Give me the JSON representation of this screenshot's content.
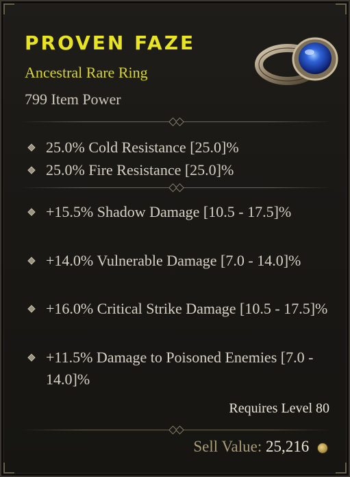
{
  "item": {
    "name": "PROVEN FAZE",
    "type": "Ancestral Rare Ring",
    "power": "799 Item Power"
  },
  "implicits": [
    "25.0% Cold Resistance [25.0]%",
    "25.0% Fire Resistance [25.0]%"
  ],
  "affixes": [
    "+15.5% Shadow Damage [10.5 - 17.5]%",
    "+14.0% Vulnerable Damage [7.0 - 14.0]%",
    "+16.0% Critical Strike Damage [10.5 - 17.5]%",
    "+11.5% Damage to Poisoned Enemies [7.0 - 14.0]%"
  ],
  "requirement": "Requires Level 80",
  "sell": {
    "label": "Sell Value:",
    "value": "25,216"
  },
  "colors": {
    "name": "#e8e422",
    "type": "#d8d630",
    "text": "#d8d2c6",
    "gem": "#2f56c9"
  },
  "icons": [
    "ring-icon",
    "bullet-icon",
    "gold-coin-icon"
  ]
}
